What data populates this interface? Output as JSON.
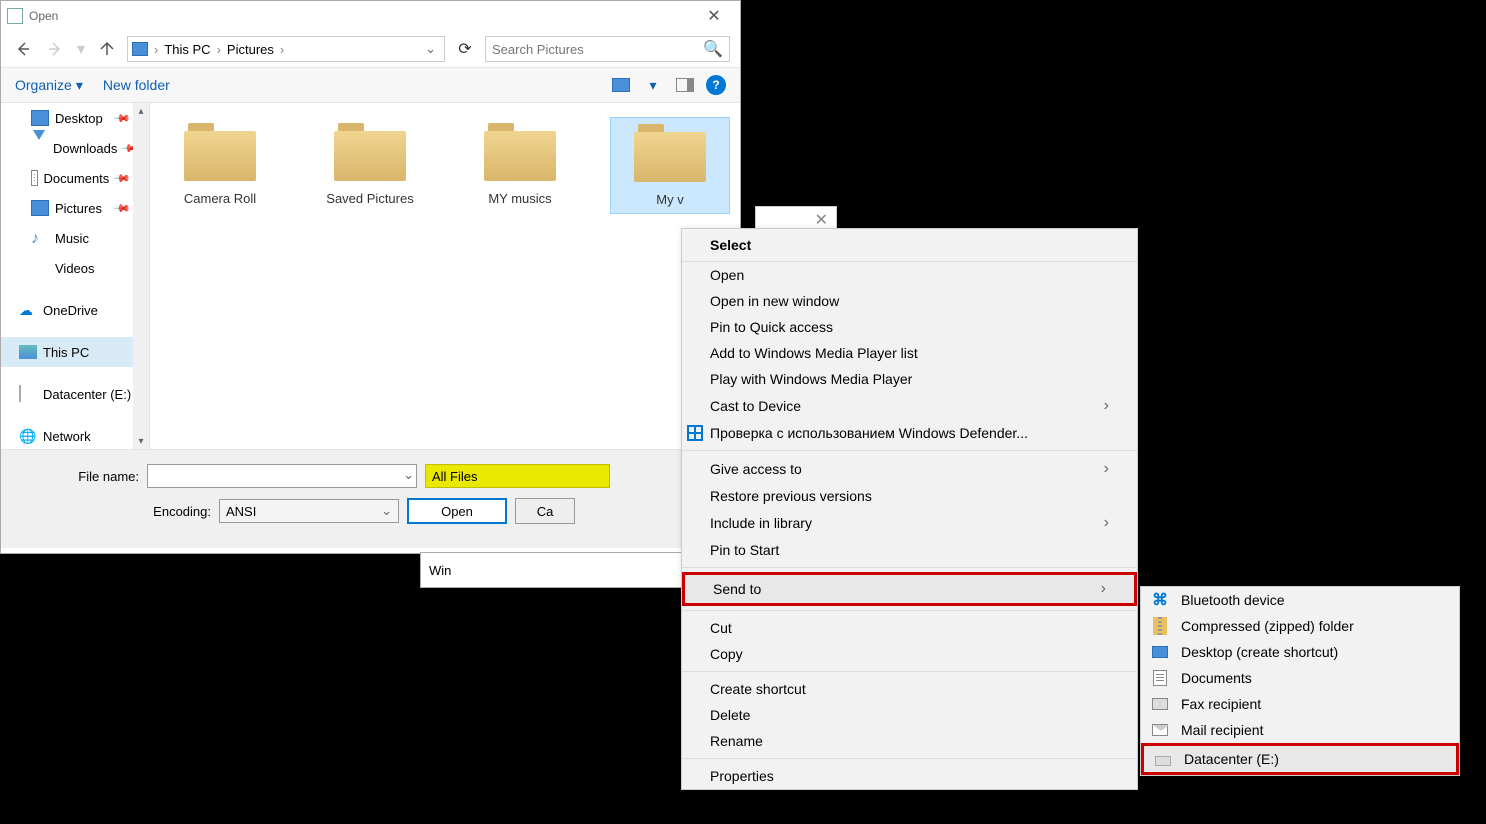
{
  "title": "Open",
  "breadcrumb": {
    "root": "This PC",
    "current": "Pictures"
  },
  "search_placeholder": "Search Pictures",
  "toolbar": {
    "organize": "Organize",
    "newfolder": "New folder"
  },
  "sidebar": {
    "desktop": "Desktop",
    "downloads": "Downloads",
    "documents": "Documents",
    "pictures": "Pictures",
    "music": "Music",
    "videos": "Videos",
    "onedrive": "OneDrive",
    "thispc": "This PC",
    "drive": "Datacenter (E:)",
    "network": "Network"
  },
  "folders": {
    "f1": "Camera Roll",
    "f2": "Saved Pictures",
    "f3": "MY musics",
    "f4": "My v"
  },
  "bottom": {
    "filename_label": "File name:",
    "filter": "All Files",
    "encoding_label": "Encoding:",
    "encoding_value": "ANSI",
    "open": "Open",
    "cancel": "Ca"
  },
  "taskbar_stub": "Win",
  "ctx": {
    "header": "Select",
    "open": "Open",
    "open_new": "Open in new window",
    "pin_quick": "Pin to Quick access",
    "add_wmp": "Add to Windows Media Player list",
    "play_wmp": "Play with Windows Media Player",
    "cast": "Cast to Device",
    "defender": "Проверка с использованием Windows Defender...",
    "give_access": "Give access to",
    "restore": "Restore previous versions",
    "include_lib": "Include in library",
    "pin_start": "Pin to Start",
    "send_to": "Send to",
    "cut": "Cut",
    "copy": "Copy",
    "shortcut": "Create shortcut",
    "delete": "Delete",
    "rename": "Rename",
    "properties": "Properties"
  },
  "sendto": {
    "bluetooth": "Bluetooth device",
    "compressed": "Compressed (zipped) folder",
    "desktop": "Desktop (create shortcut)",
    "documents": "Documents",
    "fax": "Fax recipient",
    "mail": "Mail recipient",
    "drive": "Datacenter (E:)"
  }
}
